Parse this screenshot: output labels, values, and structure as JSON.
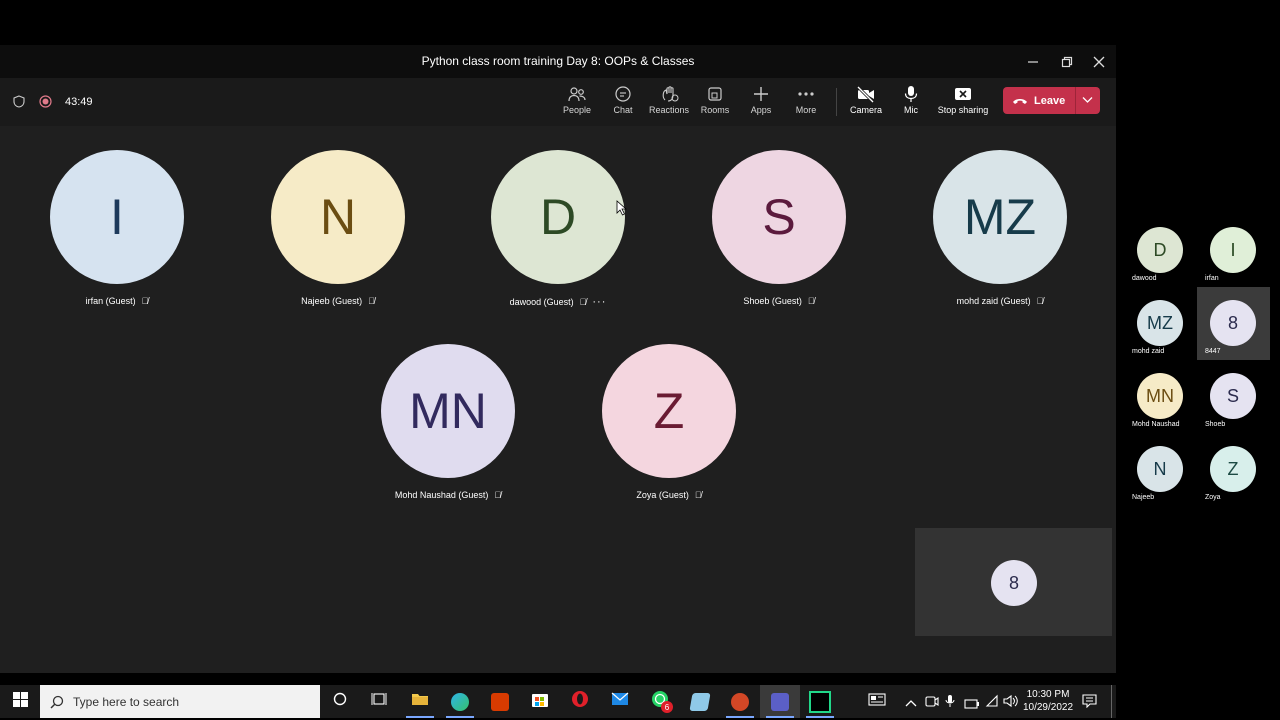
{
  "window": {
    "title": "Python class room training Day 8: OOPs & Classes"
  },
  "meeting_bar": {
    "timer": "43:49",
    "buttons": [
      {
        "label": "People",
        "icon": "people-icon"
      },
      {
        "label": "Chat",
        "icon": "chat-icon"
      },
      {
        "label": "Reactions",
        "icon": "reactions-icon"
      },
      {
        "label": "Rooms",
        "icon": "rooms-icon"
      },
      {
        "label": "Apps",
        "icon": "plus-icon"
      },
      {
        "label": "More",
        "icon": "more-icon"
      },
      {
        "label": "Camera",
        "icon": "camera-off-icon"
      },
      {
        "label": "Mic",
        "icon": "mic-icon"
      },
      {
        "label": "Stop sharing",
        "icon": "stop-sharing-icon"
      }
    ],
    "leave_label": "Leave"
  },
  "participants": [
    {
      "initials": "I",
      "label": "irfan (Guest)",
      "bg": "#d6e3f0",
      "fg": "#1d3a5c"
    },
    {
      "initials": "N",
      "label": "Najeeb (Guest)",
      "bg": "#f6ebc7",
      "fg": "#6b4d12"
    },
    {
      "initials": "D",
      "label": "dawood (Guest)",
      "bg": "#dde6d3",
      "fg": "#2d4a25"
    },
    {
      "initials": "S",
      "label": "Shoeb (Guest)",
      "bg": "#eed6e2",
      "fg": "#5b1a3d"
    },
    {
      "initials": "MZ",
      "label": "mohd zaid (Guest)",
      "bg": "#d9e4e8",
      "fg": "#173b4a"
    },
    {
      "initials": "MN",
      "label": "Mohd Naushad (Guest)",
      "bg": "#e0dcef",
      "fg": "#322a5e"
    },
    {
      "initials": "Z",
      "label": "Zoya (Guest)",
      "bg": "#f4d6df",
      "fg": "#6a1b33"
    }
  ],
  "self_tile": {
    "initials": "8"
  },
  "side_gallery": [
    {
      "initials": "D",
      "name": "dawood",
      "bg": "#dde6d3",
      "fg": "#2d4a25"
    },
    {
      "initials": "I",
      "name": "irfan",
      "bg": "#e0efd8",
      "fg": "#25451f"
    },
    {
      "initials": "MZ",
      "name": "mohd zaid",
      "bg": "#d9e4e8",
      "fg": "#173b4a"
    },
    {
      "initials": "8",
      "name": "8447",
      "bg": "#e5e3f1",
      "fg": "#2b2b4d"
    },
    {
      "initials": "MN",
      "name": "Mohd Naushad",
      "bg": "#f6ebc7",
      "fg": "#6b4d12"
    },
    {
      "initials": "S",
      "name": "Shoeb",
      "bg": "#e5e3f1",
      "fg": "#2b2b4d"
    },
    {
      "initials": "N",
      "name": "Najeeb",
      "bg": "#d9e4e8",
      "fg": "#173b4a"
    },
    {
      "initials": "Z",
      "name": "Zoya",
      "bg": "#d8efeb",
      "fg": "#1c4a43"
    }
  ],
  "taskbar": {
    "search_placeholder": "Type here to search",
    "whatsapp_badge": "6",
    "time": "10:30 PM",
    "date": "10/29/2022"
  },
  "colors": {
    "leave_red": "#c4314b",
    "accent_blue": "#7aa7ff"
  }
}
